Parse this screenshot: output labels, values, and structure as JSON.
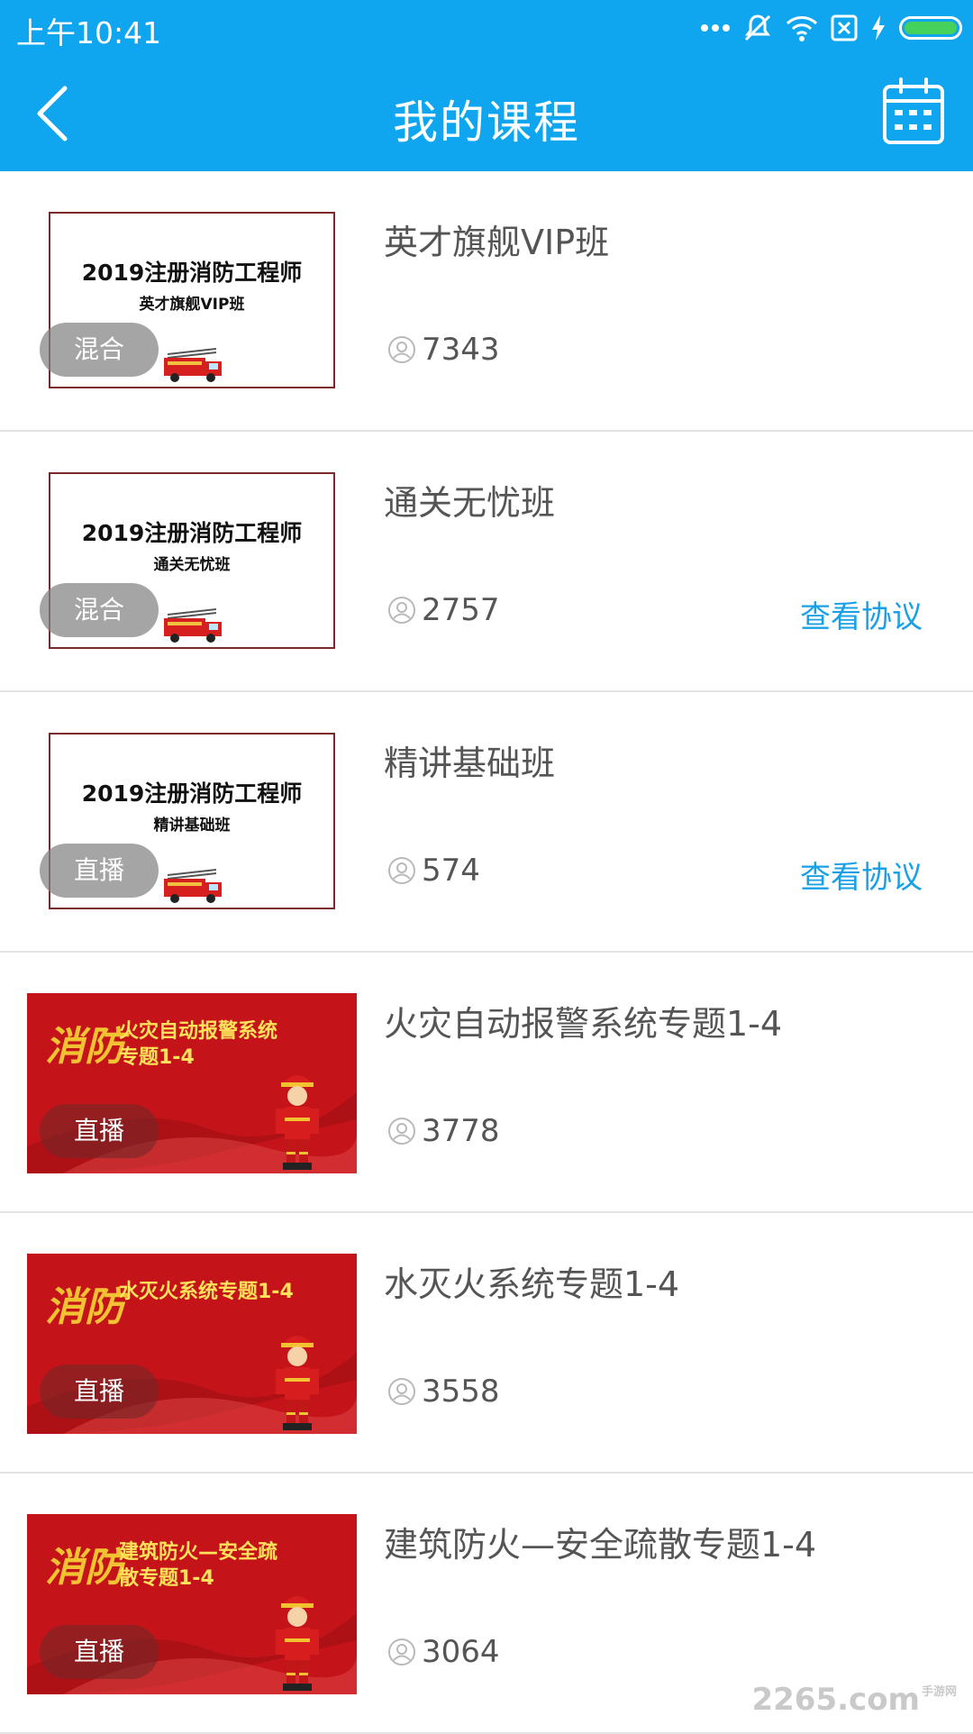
{
  "status_bar": {
    "time": "上午10:41",
    "icons": [
      "more-dots-icon",
      "mute-icon",
      "wifi-icon",
      "no-sim-icon",
      "charging-icon",
      "battery-icon"
    ]
  },
  "header": {
    "title": "我的课程",
    "back_icon": "chevron-left-icon",
    "calendar_icon": "calendar-icon",
    "bg_color": "#0fa6ef"
  },
  "courses": [
    {
      "title": "英才旗舰VIP班",
      "badge": "混合",
      "learners": "7343",
      "link": "",
      "thumb": {
        "style": "white",
        "line1": "2019注册消防工程师",
        "line2": "英才旗舰VIP班"
      }
    },
    {
      "title": "通关无忧班",
      "badge": "混合",
      "learners": "2757",
      "link": "查看协议",
      "thumb": {
        "style": "white",
        "line1": "2019注册消防工程师",
        "line2": "通关无忧班"
      }
    },
    {
      "title": "精讲基础班",
      "badge": "直播",
      "learners": "574",
      "link": "查看协议",
      "thumb": {
        "style": "white",
        "line1": "2019注册消防工程师",
        "line2": "精讲基础班"
      }
    },
    {
      "title": "火灾自动报警系统专题1-4",
      "badge": "直播",
      "learners": "3778",
      "link": "",
      "thumb": {
        "style": "red",
        "line1": "火灾自动报警系统",
        "line2": "专题1-4",
        "calligraphy": "消防"
      }
    },
    {
      "title": "水灭火系统专题1-4",
      "badge": "直播",
      "learners": "3558",
      "link": "",
      "thumb": {
        "style": "red",
        "line1": "水灭火系统专题1-4",
        "line2": "",
        "calligraphy": "消防"
      }
    },
    {
      "title": "建筑防火—安全疏散专题1-4",
      "badge": "直播",
      "learners": "3064",
      "link": "",
      "thumb": {
        "style": "red",
        "line1": "建筑防火—安全疏",
        "line2": "散专题1-4",
        "calligraphy": "消防"
      }
    }
  ],
  "watermark": {
    "brand": "2265",
    "suffix": ".com",
    "sub": "手游网"
  },
  "colors": {
    "accent": "#0fa6ef",
    "link": "#1aa0e6",
    "badge": "#828282",
    "thumb_red": "#c4141a"
  }
}
